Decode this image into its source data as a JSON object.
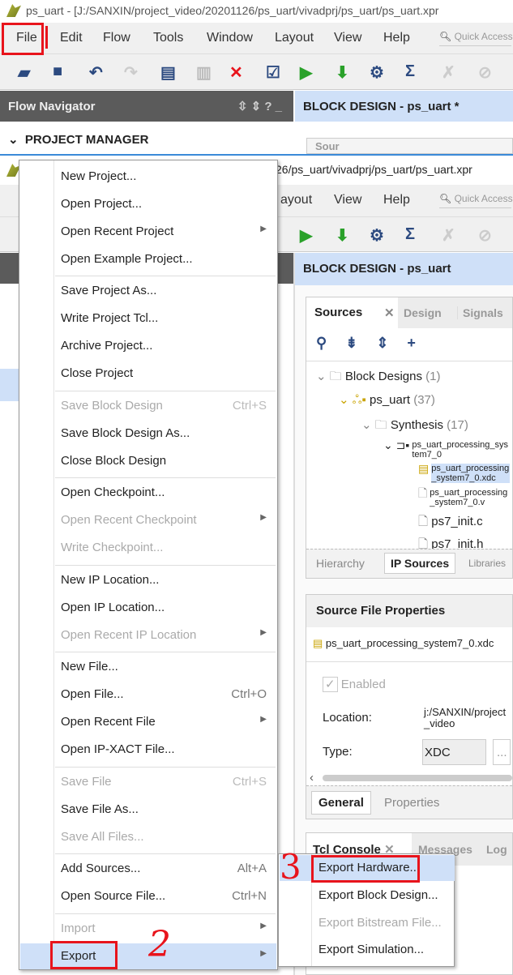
{
  "window": {
    "title": "ps_uart - [J:/SANXIN/project_video/20201126/ps_uart/vivadprj/ps_uart/ps_uart.xpr",
    "title_partial": "26/ps_uart/vivadprj/ps_uart/ps_uart.xpr"
  },
  "menubar": [
    "File",
    "Edit",
    "Flow",
    "Tools",
    "Window",
    "Layout",
    "View",
    "Help"
  ],
  "menubar_partial": [
    "ayout",
    "View",
    "Help"
  ],
  "quick_access": "Quick Access",
  "flow_navigator": {
    "title": "Flow Navigator",
    "section": "PROJECT MANAGER"
  },
  "block_design": {
    "title_modified": "BLOCK DESIGN - ps_uart *",
    "title": "BLOCK DESIGN - ps_uart"
  },
  "sources": {
    "tabs": [
      "Sources",
      "Design",
      "Signals"
    ],
    "partial_tab": "Sour",
    "tree": [
      {
        "label": "Block Designs",
        "count": "(1)"
      },
      {
        "label": "ps_uart",
        "count": "(37)"
      },
      {
        "label": "Synthesis",
        "count": "(17)"
      },
      {
        "label": "ps_uart_processing_system7_0",
        "count": ""
      },
      {
        "label": "ps_uart_processing_system7_0.xdc",
        "count": ""
      },
      {
        "label": "ps_uart_processing_system7_0.v",
        "count": ""
      },
      {
        "label": "ps7_init.c",
        "count": ""
      },
      {
        "label": "ps7_init.h",
        "count": ""
      }
    ],
    "bottom_tabs": [
      "Hierarchy",
      "IP Sources",
      "Libraries"
    ]
  },
  "properties": {
    "title": "Source File Properties",
    "file": "ps_uart_processing_system7_0.xdc",
    "enabled_label": "Enabled",
    "location_label": "Location:",
    "location_value": "j:/SANXIN/project_video",
    "type_label": "Type:",
    "type_value": "XDC",
    "browse": "...",
    "tabs": [
      "General",
      "Properties"
    ]
  },
  "console": {
    "tabs": [
      "Tcl Console",
      "Messages",
      "Log"
    ]
  },
  "file_menu": [
    {
      "label": "New Project...",
      "group": 0
    },
    {
      "label": "Open Project...",
      "group": 0
    },
    {
      "label": "Open Recent Project",
      "submenu": true,
      "group": 0
    },
    {
      "label": "Open Example Project...",
      "group": 0
    },
    {
      "label": "Save Project As...",
      "group": 1
    },
    {
      "label": "Write Project Tcl...",
      "group": 1
    },
    {
      "label": "Archive Project...",
      "group": 1
    },
    {
      "label": "Close Project",
      "group": 1
    },
    {
      "label": "Save Block Design",
      "shortcut": "Ctrl+S",
      "disabled": true,
      "group": 2
    },
    {
      "label": "Save Block Design As...",
      "group": 2
    },
    {
      "label": "Close Block Design",
      "group": 2
    },
    {
      "label": "Open Checkpoint...",
      "group": 3
    },
    {
      "label": "Open Recent Checkpoint",
      "submenu": true,
      "disabled": true,
      "group": 3
    },
    {
      "label": "Write Checkpoint...",
      "disabled": true,
      "group": 3
    },
    {
      "label": "New IP Location...",
      "group": 4
    },
    {
      "label": "Open IP Location...",
      "group": 4
    },
    {
      "label": "Open Recent IP Location",
      "submenu": true,
      "disabled": true,
      "group": 4
    },
    {
      "label": "New File...",
      "group": 5
    },
    {
      "label": "Open File...",
      "shortcut": "Ctrl+O",
      "group": 5
    },
    {
      "label": "Open Recent File",
      "submenu": true,
      "group": 5
    },
    {
      "label": "Open IP-XACT File...",
      "group": 5
    },
    {
      "label": "Save File",
      "shortcut": "Ctrl+S",
      "disabled": true,
      "group": 6
    },
    {
      "label": "Save File As...",
      "group": 6
    },
    {
      "label": "Save All Files...",
      "disabled": true,
      "group": 6
    },
    {
      "label": "Add Sources...",
      "shortcut": "Alt+A",
      "group": 7
    },
    {
      "label": "Open Source File...",
      "shortcut": "Ctrl+N",
      "group": 7
    },
    {
      "label": "Import",
      "submenu": true,
      "disabled": true,
      "group": 8
    },
    {
      "label": "Export",
      "submenu": true,
      "highlighted": true,
      "group": 8
    }
  ],
  "export_submenu": [
    {
      "label": "Export Hardware...",
      "highlighted": true
    },
    {
      "label": "Export Block Design..."
    },
    {
      "label": "Export Bitstream File...",
      "disabled": true
    },
    {
      "label": "Export Simulation..."
    }
  ],
  "annotations": {
    "step2": "2",
    "step3": "3",
    "color": "#e8141c"
  },
  "colors": {
    "highlight": "#cfe0f8",
    "nav_header": "#5b5b5b"
  }
}
